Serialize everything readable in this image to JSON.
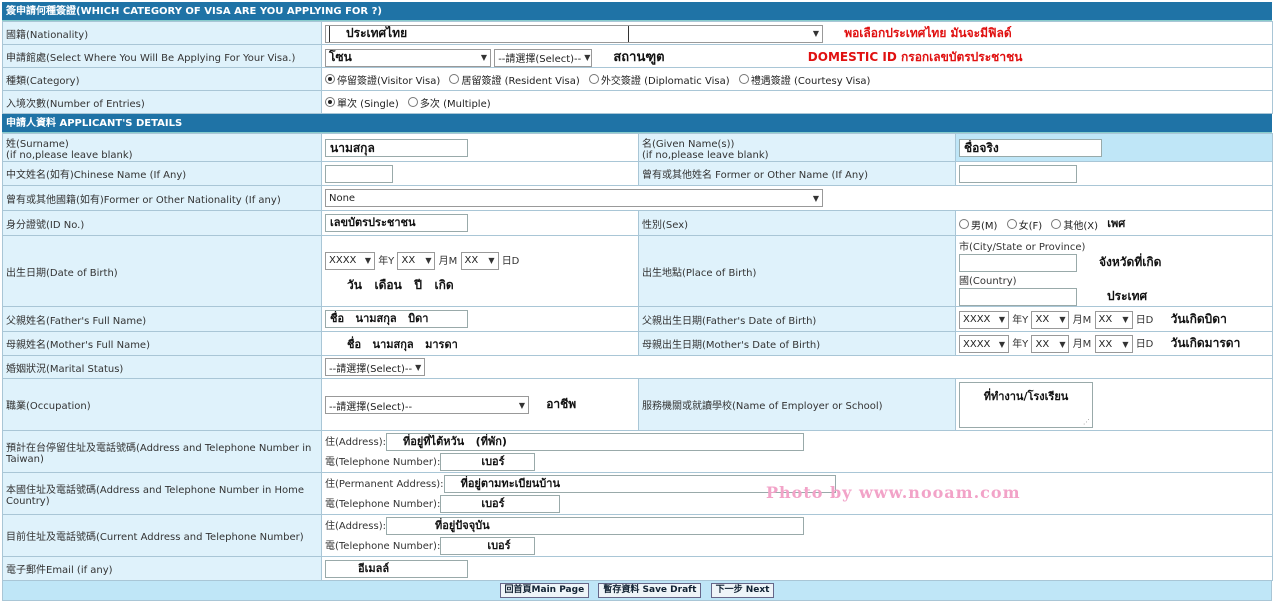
{
  "visa_section": {
    "header": "簽申請何種簽證(WHICH CATEGORY OF VISA ARE YOU APPLYING FOR ?)",
    "nationality": {
      "label": "國籍(Nationality)",
      "value": "ประเทศไทย",
      "note": "พอเลือกประเทศไทย  มันจะมีฟิลด์"
    },
    "location": {
      "label": "申請館處(Select Where You Will Be Applying For Your Visa.)",
      "value": "โซน",
      "select2": "--請選擇(Select)--",
      "annotation": "สถานฑูต",
      "note": "DOMESTIC ID กรอกเลขบัตรประชาชน"
    },
    "category": {
      "label": "種類(Category)",
      "options": [
        "停留簽證(Visitor Visa)",
        "居留簽證 (Resident Visa)",
        "外交簽證 (Diplomatic Visa)",
        "禮遇簽證 (Courtesy Visa)"
      ]
    },
    "entries": {
      "label": "入境次數(Number of Entries)",
      "options": [
        "單次 (Single)",
        "多次 (Multiple)"
      ]
    }
  },
  "applicant": {
    "header": "申請人資料 APPLICANT'S DETAILS",
    "surname": {
      "label1": "姓(Surname)",
      "label2": "(if no,please leave blank)",
      "value": "นามสกุล"
    },
    "given": {
      "label1": "名(Given Name(s))",
      "label2": "(if no,please leave blank)",
      "value": "ชื่อจริง"
    },
    "chinese_name": {
      "label": "中文姓名(如有)Chinese Name (If Any)"
    },
    "former_name": {
      "label": "曾有或其他姓名 Former or Other Name (If Any)"
    },
    "former_nationality": {
      "label": "曾有或其他國籍(如有)Former or Other Nationality (If any)",
      "value": "None"
    },
    "id_no": {
      "label": "身分證號(ID No.)",
      "value": "เลขบัตรประชาชน"
    },
    "sex": {
      "label": "性別(Sex)",
      "options": [
        "男(M)",
        "女(F)",
        "其他(X)"
      ],
      "annotation": "เพศ"
    },
    "dob": {
      "label": "出生日期(Date of Birth)",
      "year": "XXXX",
      "year_unit": "年Y",
      "month": "XX",
      "month_unit": "月M",
      "day": "XX",
      "day_unit": "日D",
      "annotation": "วัน   เดือน   ปี   เกิด"
    },
    "pob": {
      "label": "出生地點(Place of Birth)",
      "city_label": "市(City/State or Province)",
      "city_annotation": "จังหวัดที่เกิด",
      "country_label": "國(Country)",
      "country_annotation": "ประเทศ"
    },
    "father_name": {
      "label": "父親姓名(Father's Full Name)",
      "value": "ชื่อ   นามสกุล   บิดา"
    },
    "father_dob": {
      "label": "父親出生日期(Father's Date of Birth)",
      "year": "XXXX",
      "year_unit": "年Y",
      "month": "XX",
      "month_unit": "月M",
      "day": "XX",
      "day_unit": "日D",
      "annotation": "วันเกิดบิดา"
    },
    "mother_name": {
      "label": "母親姓名(Mother's Full Name)",
      "value": "ชื่อ   นามสกุล   มารดา"
    },
    "mother_dob": {
      "label": "母親出生日期(Mother's Date of Birth)",
      "year": "XXXX",
      "year_unit": "年Y",
      "month": "XX",
      "month_unit": "月M",
      "day": "XX",
      "day_unit": "日D",
      "annotation": "วันเกิดมารดา"
    },
    "marital": {
      "label": "婚姻狀況(Marital Status)",
      "value": "--請選擇(Select)--"
    },
    "occupation": {
      "label": "職業(Occupation)",
      "value": "--請選擇(Select)--",
      "annotation": "อาชีพ"
    },
    "employer": {
      "label": "服務機關或就讀學校(Name of Employer or School)",
      "value": "ที่ทำงาน/โรงเรียน"
    },
    "taiwan_addr": {
      "label": "預計在台停留住址及電話號碼(Address and Telephone Number in Taiwan)",
      "addr_label": "住(Address):",
      "addr_value": "ที่อยู่ที่ไต้หวัน   (ที่พัก)",
      "tel_label": "電(Telephone Number):",
      "tel_value": "เบอร์"
    },
    "home_addr": {
      "label": "本國住址及電話號碼(Address and Telephone Number in Home Country)",
      "addr_label": "住(Permanent Address):",
      "addr_value": "ที่อยู่ตามทะเบียนบ้าน",
      "tel_label": "電(Telephone Number):",
      "tel_value": "เบอร์"
    },
    "current_addr": {
      "label": "目前住址及電話號碼(Current Address and Telephone Number)",
      "addr_label": "住(Address):",
      "addr_value": "ที่อยู่ปัจจุบัน",
      "tel_label": "電(Telephone Number):",
      "tel_value": "เบอร์"
    },
    "email": {
      "label": "電子郵件Email (if any)",
      "value": "อีเมลล์"
    }
  },
  "buttons": {
    "main": "回首頁Main Page",
    "save": "暫存資料 Save Draft",
    "next": "下一步 Next"
  },
  "watermark": "Photo by www.nooam.com"
}
